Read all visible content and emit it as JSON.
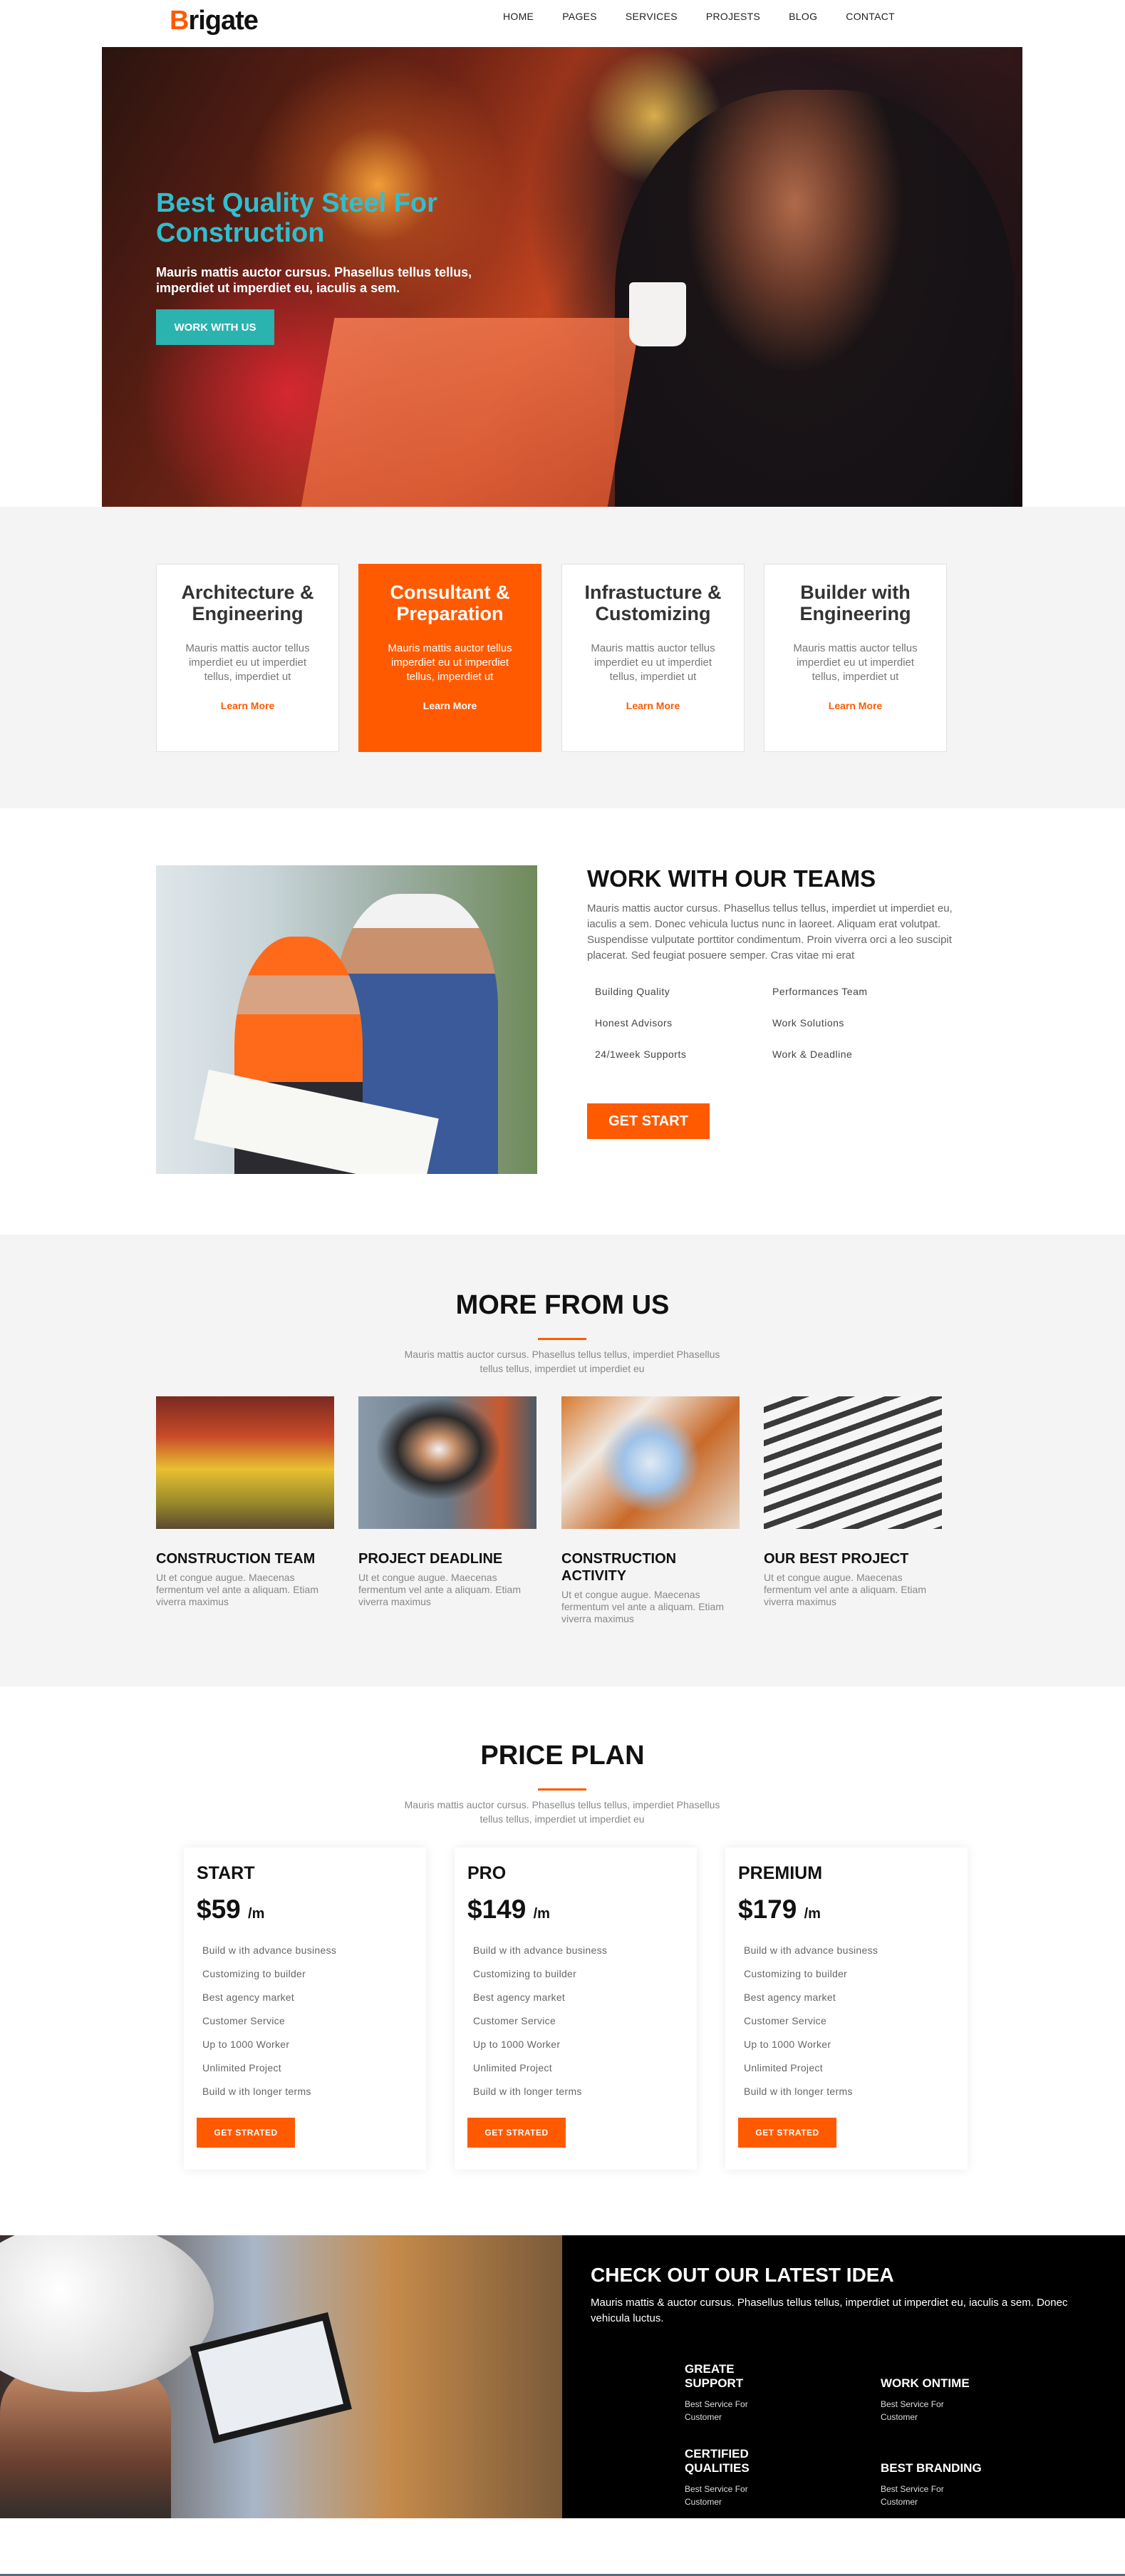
{
  "header": {
    "logo_first": "B",
    "logo_rest": "rigate",
    "nav": [
      "HOME",
      "PAGES",
      "SERVICES",
      "PROJESTS",
      "BLOG",
      "CONTACT"
    ]
  },
  "hero": {
    "title": "Best Quality Steel For Construction",
    "text": "Mauris mattis auctor cursus. Phasellus tellus tellus, imperdiet ut imperdiet eu, iaculis a sem.",
    "button": "WORK WITH US"
  },
  "services": [
    {
      "title": "Architecture & Engineering",
      "text": "Mauris mattis auctor tellus imperdiet eu ut imperdiet tellus, imperdiet ut",
      "link": "Learn More"
    },
    {
      "title": "Consultant & Preparation",
      "text": "Mauris mattis auctor tellus imperdiet eu ut imperdiet tellus, imperdiet ut",
      "link": "Learn More"
    },
    {
      "title": "Infrastucture & Customizing",
      "text": "Mauris mattis auctor tellus imperdiet eu ut imperdiet tellus, imperdiet ut",
      "link": "Learn More"
    },
    {
      "title": "Builder with Engineering",
      "text": "Mauris mattis auctor tellus imperdiet eu ut imperdiet tellus, imperdiet ut",
      "link": "Learn More"
    }
  ],
  "teams": {
    "title": "WORK WITH OUR TEAMS",
    "text": "Mauris mattis auctor cursus. Phasellus tellus tellus, imperdiet ut imperdiet eu, iaculis a sem. Donec vehicula luctus nunc in laoreet. Aliquam erat volutpat. Suspendisse vulputate porttitor condimentum. Proin viverra orci a leo suscipit placerat. Sed feugiat posuere semper. Cras vitae mi erat",
    "features": [
      "Building Quality",
      "Performances Team",
      "Honest Advisors",
      "Work Solutions",
      "24/1week Supports",
      "Work & Deadline"
    ],
    "button": "GET START"
  },
  "more": {
    "title": "MORE FROM US",
    "subtitle": "Mauris mattis auctor cursus. Phasellus tellus tellus, imperdiet Phasellus tellus tellus, imperdiet ut imperdiet eu",
    "items": [
      {
        "title": "CONSTRUCTION TEAM",
        "text": "Ut et congue augue. Maecenas fermentum vel ante a aliquam. Etiam viverra maximus"
      },
      {
        "title": "PROJECT DEADLINE",
        "text": "Ut et congue augue. Maecenas fermentum vel ante a aliquam. Etiam viverra maximus"
      },
      {
        "title": "CONSTRUCTION ACTIVITY",
        "text": "Ut et congue augue. Maecenas fermentum vel ante a aliquam. Etiam viverra maximus"
      },
      {
        "title": "OUR BEST PROJECT",
        "text": "Ut et congue augue. Maecenas fermentum vel ante a aliquam. Etiam viverra maximus"
      }
    ]
  },
  "pricing": {
    "title": "PRICE PLAN",
    "subtitle": "Mauris mattis auctor cursus. Phasellus tellus tellus, imperdiet Phasellus tellus tellus, imperdiet ut imperdiet eu",
    "plans": [
      {
        "name": "START",
        "price": "$59",
        "per": "/m"
      },
      {
        "name": "PRO",
        "price": "$149",
        "per": "/m"
      },
      {
        "name": "PREMIUM",
        "price": "$179",
        "per": "/m"
      }
    ],
    "features": [
      "Build w ith advance business",
      "Customizing to builder",
      "Best agency market",
      "Customer Service",
      "Up to 1000 Worker",
      "Unlimited Project",
      "Build w ith longer terms"
    ],
    "button": "GET STRATED"
  },
  "idea": {
    "title": "CHECK OUT OUR LATEST IDEA",
    "text": "Mauris mattis & auctor cursus. Phasellus tellus tellus, imperdiet ut imperdiet eu, iaculis a sem. Donec vehicula luctus.",
    "items": [
      {
        "title": "GREATE SUPPORT",
        "text": "Best Service For Customer"
      },
      {
        "title": "WORK ONTIME",
        "text": "Best Service For Customer"
      },
      {
        "title": "CERTIFIED QUALITIES",
        "text": "Best Service For Customer"
      },
      {
        "title": "BEST BRANDING",
        "text": "Best Service For Customer"
      }
    ]
  },
  "colors": {
    "accent": "#ff5a00",
    "teal": "#2bb3b0",
    "hero_title": "#2fbfd0"
  }
}
